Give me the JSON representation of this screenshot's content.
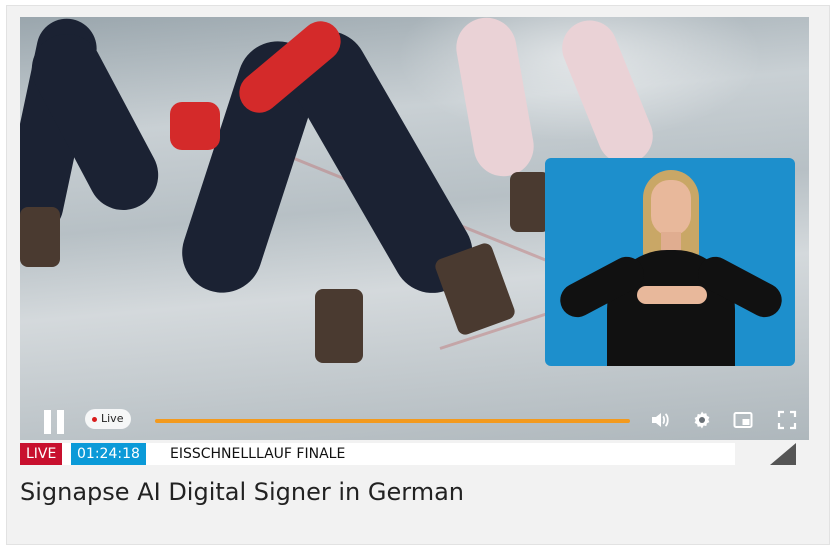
{
  "player": {
    "live_pill": "Live",
    "controls": {
      "pause_icon": "pause-icon",
      "volume_icon": "volume-icon",
      "settings_icon": "gear-icon",
      "pip_icon": "picture-in-picture-icon",
      "fullscreen_icon": "fullscreen-icon"
    },
    "colors": {
      "progress": "#f39a1e",
      "signer_bg": "#1d8fcc",
      "live_red": "#c8102e",
      "time_blue": "#0b9ad8"
    }
  },
  "ticker": {
    "live_label": "LIVE",
    "time": "01:24:18",
    "title": "EISSCHNELLLAUF FINALE"
  },
  "caption": "Signapse AI Digital Signer in German"
}
